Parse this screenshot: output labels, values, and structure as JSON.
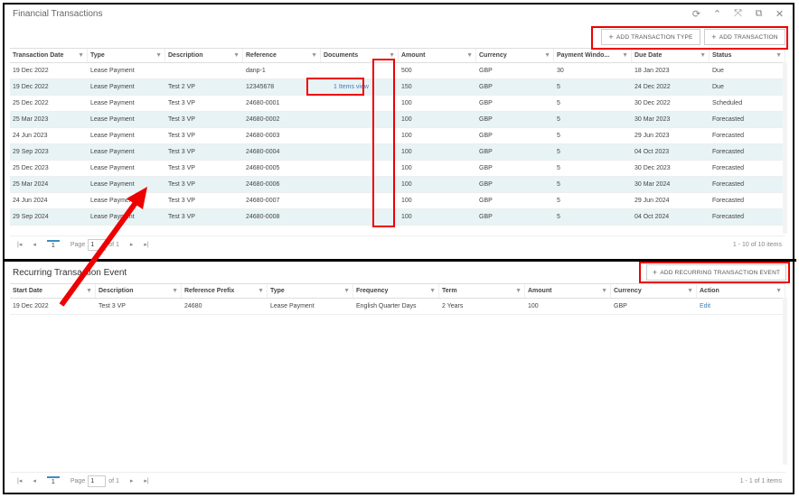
{
  "top_panel": {
    "title": "Financial Transactions",
    "icons": [
      "refresh-icon",
      "collapse-icon",
      "expand-icon",
      "popout-icon",
      "close-icon"
    ],
    "buttons": {
      "add_type": "ADD TRANSACTION TYPE",
      "add_transaction": "ADD TRANSACTION"
    },
    "columns": [
      "Transaction Date",
      "Type",
      "Description",
      "Reference",
      "Documents",
      "Amount",
      "Currency",
      "Payment Windo...",
      "Due Date",
      "Status"
    ],
    "rows": [
      [
        "19 Dec 2022",
        "Lease Payment",
        "",
        "danp-1",
        "",
        "500",
        "GBP",
        "30",
        "18 Jan 2023",
        "Due"
      ],
      [
        "19 Dec 2022",
        "Lease Payment",
        "Test 2 VP",
        "12345678",
        "1 Items view",
        "150",
        "GBP",
        "5",
        "24 Dec 2022",
        "Due"
      ],
      [
        "25 Dec 2022",
        "Lease Payment",
        "Test 3 VP",
        "24680-0001",
        "",
        "100",
        "GBP",
        "5",
        "30 Dec 2022",
        "Scheduled"
      ],
      [
        "25 Mar 2023",
        "Lease Payment",
        "Test 3 VP",
        "24680-0002",
        "",
        "100",
        "GBP",
        "5",
        "30 Mar 2023",
        "Forecasted"
      ],
      [
        "24 Jun 2023",
        "Lease Payment",
        "Test 3 VP",
        "24680-0003",
        "",
        "100",
        "GBP",
        "5",
        "29 Jun 2023",
        "Forecasted"
      ],
      [
        "29 Sep 2023",
        "Lease Payment",
        "Test 3 VP",
        "24680-0004",
        "",
        "100",
        "GBP",
        "5",
        "04 Oct 2023",
        "Forecasted"
      ],
      [
        "25 Dec 2023",
        "Lease Payment",
        "Test 3 VP",
        "24680-0005",
        "",
        "100",
        "GBP",
        "5",
        "30 Dec 2023",
        "Forecasted"
      ],
      [
        "25 Mar 2024",
        "Lease Payment",
        "Test 3 VP",
        "24680-0006",
        "",
        "100",
        "GBP",
        "5",
        "30 Mar 2024",
        "Forecasted"
      ],
      [
        "24 Jun 2024",
        "Lease Payment",
        "Test 3 VP",
        "24680-0007",
        "",
        "100",
        "GBP",
        "5",
        "29 Jun 2024",
        "Forecasted"
      ],
      [
        "29 Sep 2024",
        "Lease Payment",
        "Test 3 VP",
        "24680-0008",
        "",
        "100",
        "GBP",
        "5",
        "04 Oct 2024",
        "Forecasted"
      ]
    ],
    "pager": {
      "current_page": "1",
      "page_label": "Page",
      "page_input": "1",
      "of_label": "of 1",
      "summary": "1 - 10 of 10 items"
    }
  },
  "bottom_panel": {
    "title": "Recurring Transaction Event",
    "buttons": {
      "add_recurring": "ADD RECURRING TRANSACTION EVENT"
    },
    "columns": [
      "Start Date",
      "Description",
      "Reference Prefix",
      "Type",
      "Frequency",
      "Term",
      "Amount",
      "Currency",
      "Action"
    ],
    "rows": [
      [
        "19 Dec 2022",
        "Test 3 VP",
        "24680",
        "Lease Payment",
        "English Quarter Days",
        "2 Years",
        "100",
        "GBP",
        "Edit"
      ]
    ],
    "pager": {
      "current_page": "1",
      "page_label": "Page",
      "page_input": "1",
      "of_label": "of 1",
      "summary": "1 - 1 of 1 items"
    }
  },
  "colors": {
    "annotation": "#e00000",
    "row_alt": "#e8f3f6",
    "link": "#3c7db5",
    "doc_icon": "#1b3a5c"
  }
}
